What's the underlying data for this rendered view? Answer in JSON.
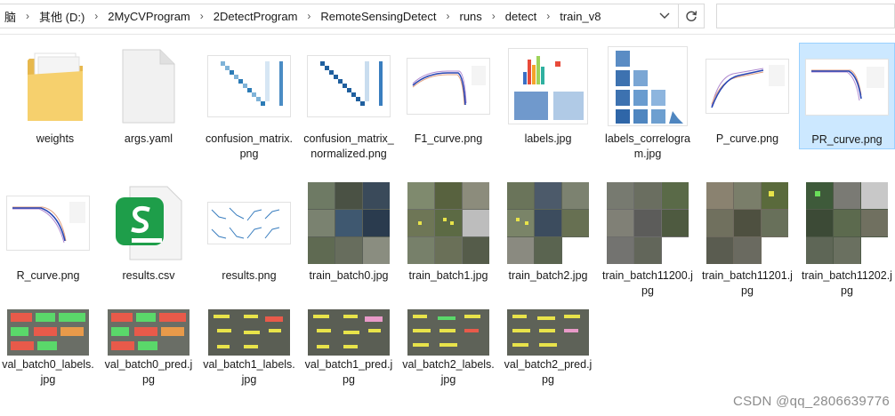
{
  "address": {
    "crumbs": [
      "脑",
      "其他 (D:)",
      "2MyCVProgram",
      "2DetectProgram",
      "RemoteSensingDetect",
      "runs",
      "detect",
      "train_v8"
    ],
    "separator": "›"
  },
  "files": [
    {
      "name": "weights",
      "icon": "folder-icon"
    },
    {
      "name": "args.yaml",
      "icon": "document-icon"
    },
    {
      "name": "confusion_matrix.png",
      "icon": "image-thumbnail"
    },
    {
      "name": "confusion_matrix_normalized.png",
      "icon": "image-thumbnail"
    },
    {
      "name": "F1_curve.png",
      "icon": "image-thumbnail"
    },
    {
      "name": "labels.jpg",
      "icon": "image-thumbnail"
    },
    {
      "name": "labels_correlogram.jpg",
      "icon": "image-thumbnail"
    },
    {
      "name": "P_curve.png",
      "icon": "image-thumbnail"
    },
    {
      "name": "PR_curve.png",
      "icon": "image-thumbnail",
      "selected": true
    },
    {
      "name": "R_curve.png",
      "icon": "image-thumbnail"
    },
    {
      "name": "results.csv",
      "icon": "spreadsheet-icon"
    },
    {
      "name": "results.png",
      "icon": "image-thumbnail"
    },
    {
      "name": "train_batch0.jpg",
      "icon": "image-thumbnail"
    },
    {
      "name": "train_batch1.jpg",
      "icon": "image-thumbnail"
    },
    {
      "name": "train_batch2.jpg",
      "icon": "image-thumbnail"
    },
    {
      "name": "train_batch11200.jpg",
      "icon": "image-thumbnail"
    },
    {
      "name": "train_batch11201.jpg",
      "icon": "image-thumbnail"
    },
    {
      "name": "train_batch11202.jpg",
      "icon": "image-thumbnail"
    },
    {
      "name": "val_batch0_labels.jpg",
      "icon": "image-thumbnail"
    },
    {
      "name": "val_batch0_pred.jpg",
      "icon": "image-thumbnail"
    },
    {
      "name": "val_batch1_labels.jpg",
      "icon": "image-thumbnail"
    },
    {
      "name": "val_batch1_pred.jpg",
      "icon": "image-thumbnail"
    },
    {
      "name": "val_batch2_labels.jpg",
      "icon": "image-thumbnail"
    },
    {
      "name": "val_batch2_pred.jpg",
      "icon": "image-thumbnail"
    }
  ],
  "watermark": "CSDN @qq_2806639776",
  "colors": {
    "selection": "#cce8ff",
    "folder": "#f6d06d",
    "csv_green": "#1e9e4a"
  }
}
